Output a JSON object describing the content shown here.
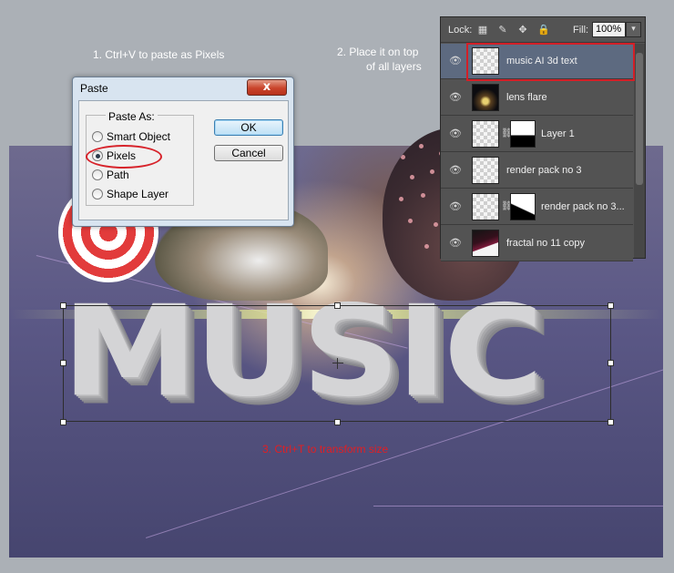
{
  "instructions": {
    "step1": "1. Ctrl+V to paste as Pixels",
    "step2_line1": "2. Place it on top",
    "step2_line2": "of all layers",
    "step3": "3. Ctrl+T to transform size"
  },
  "artwork": {
    "text": "MUSIC"
  },
  "paste_dialog": {
    "title": "Paste",
    "close_label": "x",
    "group_label": "Paste As:",
    "options": [
      {
        "label": "Smart Object",
        "selected": false
      },
      {
        "label": "Pixels",
        "selected": true
      },
      {
        "label": "Path",
        "selected": false
      },
      {
        "label": "Shape Layer",
        "selected": false
      }
    ],
    "ok_label": "OK",
    "cancel_label": "Cancel"
  },
  "layers_panel": {
    "lock_label": "Lock:",
    "fill_label": "Fill:",
    "fill_value": "100%",
    "layers": [
      {
        "name": "music AI 3d text",
        "selected": true,
        "thumb": "transparent",
        "mask": false
      },
      {
        "name": "lens flare",
        "selected": false,
        "thumb": "dark",
        "mask": false
      },
      {
        "name": "Layer 1",
        "selected": false,
        "thumb": "transparent",
        "mask": true
      },
      {
        "name": "render pack no 3",
        "selected": false,
        "thumb": "transparent",
        "mask": false
      },
      {
        "name": "render pack no 3...",
        "selected": false,
        "thumb": "transparent",
        "mask": true
      },
      {
        "name": "fractal no 11 copy",
        "selected": false,
        "thumb": "fractal",
        "mask": false
      }
    ]
  },
  "colors": {
    "annotation_red": "#d31f27",
    "selected_layer": "#5d6a80",
    "background": "#abb0b6"
  }
}
